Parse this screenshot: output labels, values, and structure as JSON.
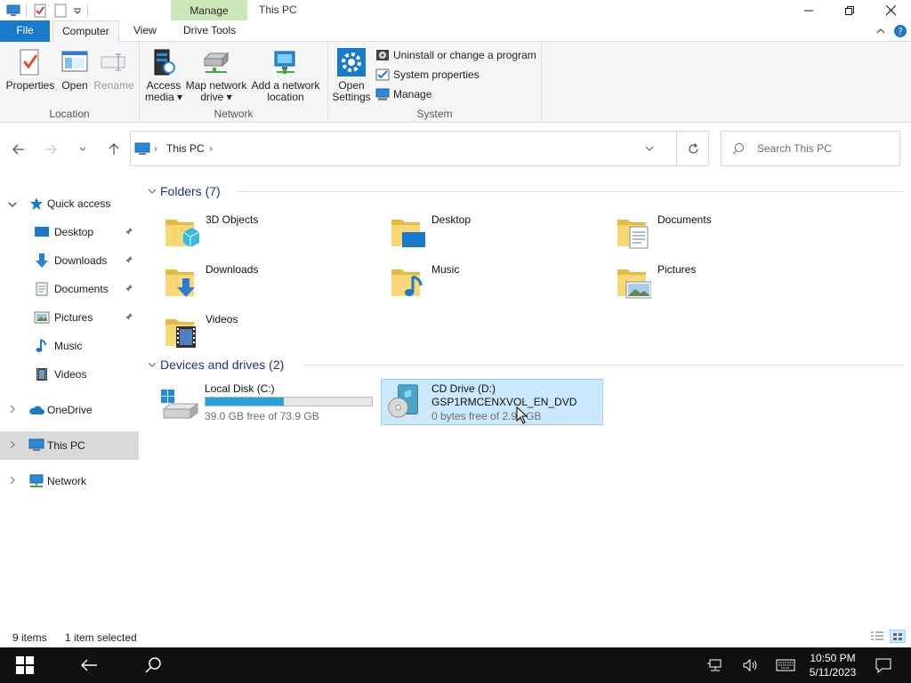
{
  "titlebar": {
    "context_tab": "Manage",
    "window_title": "This PC",
    "minimize": "—",
    "maximize": "☐",
    "close": "✕"
  },
  "tabs": {
    "file": "File",
    "computer": "Computer",
    "view": "View",
    "drive_tools": "Drive Tools"
  },
  "ribbon": {
    "location": {
      "label": "Location",
      "properties": "Properties",
      "open": "Open",
      "rename": "Rename"
    },
    "network": {
      "label": "Network",
      "access_media_1": "Access",
      "access_media_2": "media ▾",
      "map_drive_1": "Map network",
      "map_drive_2": "drive ▾",
      "add_location_1": "Add a network",
      "add_location_2": "location"
    },
    "system": {
      "label": "System",
      "open_settings_1": "Open",
      "open_settings_2": "Settings",
      "uninstall": "Uninstall or change a program",
      "system_properties": "System properties",
      "manage": "Manage"
    }
  },
  "address": {
    "breadcrumb": "This PC",
    "search_placeholder": "Search This PC"
  },
  "navpane": {
    "quick_access": "Quick access",
    "items": [
      {
        "label": "Desktop",
        "pinned": true
      },
      {
        "label": "Downloads",
        "pinned": true
      },
      {
        "label": "Documents",
        "pinned": true
      },
      {
        "label": "Pictures",
        "pinned": true
      },
      {
        "label": "Music",
        "pinned": false
      },
      {
        "label": "Videos",
        "pinned": false
      }
    ],
    "onedrive": "OneDrive",
    "this_pc": "This PC",
    "network": "Network"
  },
  "content": {
    "folders_header": "Folders (7)",
    "folders": [
      {
        "name": "3D Objects"
      },
      {
        "name": "Desktop"
      },
      {
        "name": "Documents"
      },
      {
        "name": "Downloads"
      },
      {
        "name": "Music"
      },
      {
        "name": "Pictures"
      },
      {
        "name": "Videos"
      }
    ],
    "drives_header": "Devices and drives (2)",
    "drives": [
      {
        "name": "Local Disk (C:)",
        "free": "39.0 GB free of 73.9 GB",
        "used_fraction": 0.472
      },
      {
        "name": "CD Drive (D:)",
        "label": "GSP1RMCENXVOL_EN_DVD",
        "free": "0 bytes free of 2.92 GB"
      }
    ]
  },
  "status": {
    "items": "9 items",
    "selected": "1 item selected"
  },
  "taskbar": {
    "time": "10:50 PM",
    "date": "5/11/2023"
  },
  "colors": {
    "accent": "#1979ca",
    "selection": "#cce8ff",
    "context_tab": "#cce8b8",
    "progress": "#26a0da"
  }
}
